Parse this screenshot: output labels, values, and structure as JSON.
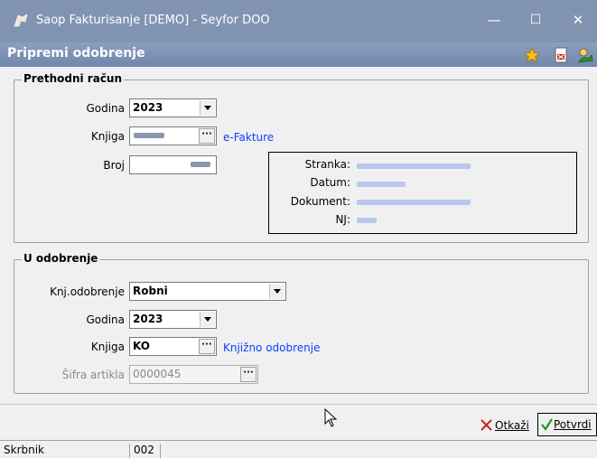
{
  "window": {
    "title": "Saop Fakturisanje [DEMO] - Seyfor DOO",
    "minimize": "—",
    "maximize": "☐",
    "close": "✕"
  },
  "dialog": {
    "title": "Pripremi odobrenje",
    "toolbar_icons": [
      "star-icon",
      "pdf-doc-icon",
      "green-person-icon"
    ]
  },
  "prethodni": {
    "legend": "Prethodni račun",
    "godina_label": "Godina",
    "godina_value": "2023",
    "knjiga_label": "Knjiga",
    "knjiga_link": "e-Fakture",
    "broj_label": "Broj",
    "info": {
      "stranka_label": "Stranka:",
      "datum_label": "Datum:",
      "dokument_label": "Dokument:",
      "nj_label": "NJ:"
    }
  },
  "odobrenje": {
    "legend": "U odobrenje",
    "knj_label": "Knj.odobrenje",
    "knj_value": "Robni",
    "godina_label": "Godina",
    "godina_value": "2023",
    "knjiga_label": "Knjiga",
    "knjiga_value": "KO",
    "knjiga_link": "Knjižno odobrenje",
    "sifra_label": "Šifra artikla",
    "sifra_value": "0000045"
  },
  "buttons": {
    "dots": "···",
    "cancel_label": "Otkaži",
    "confirm_label": "Potvrdi"
  },
  "statusbar": {
    "user": "Skrbnik",
    "code": "002"
  }
}
